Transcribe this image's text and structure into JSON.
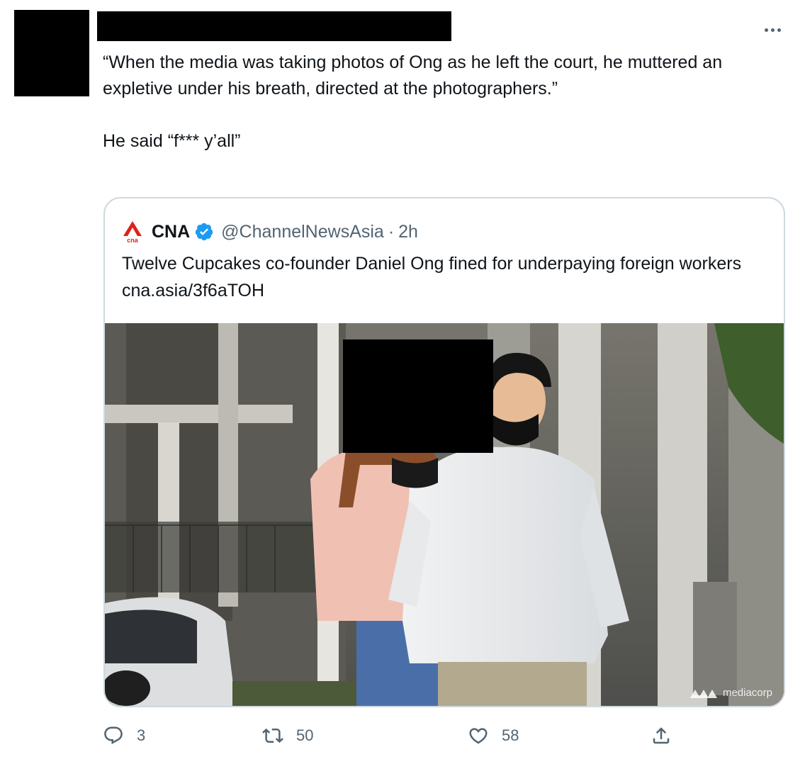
{
  "tweet": {
    "text": "“When the media was taking photos of Ong as he left the court, he muttered an expletive under his breath, directed at the photographers.”\n\nHe said “f*** y’all”"
  },
  "quoted_tweet": {
    "display_name": "CNA",
    "handle": "@ChannelNewsAsia",
    "separator": "·",
    "time": "2h",
    "logo_text": "cna",
    "text": "Twelve Cupcakes co-founder Daniel Ong fined for underpaying foreign workers cna.asia/3f6aTOH",
    "photo_watermark": "mediacorp"
  },
  "actions": {
    "reply_count": "3",
    "retweet_count": "50",
    "like_count": "58"
  },
  "icons": {
    "more": "more-horizontal-icon",
    "verified": "verified-badge-icon",
    "reply": "reply-icon",
    "retweet": "retweet-icon",
    "like": "heart-icon",
    "share": "share-icon"
  },
  "colors": {
    "text": "#0f1419",
    "secondary": "#536471",
    "border": "#cfd9de",
    "verified": "#1d9bf0",
    "cna_red": "#e0201b"
  }
}
